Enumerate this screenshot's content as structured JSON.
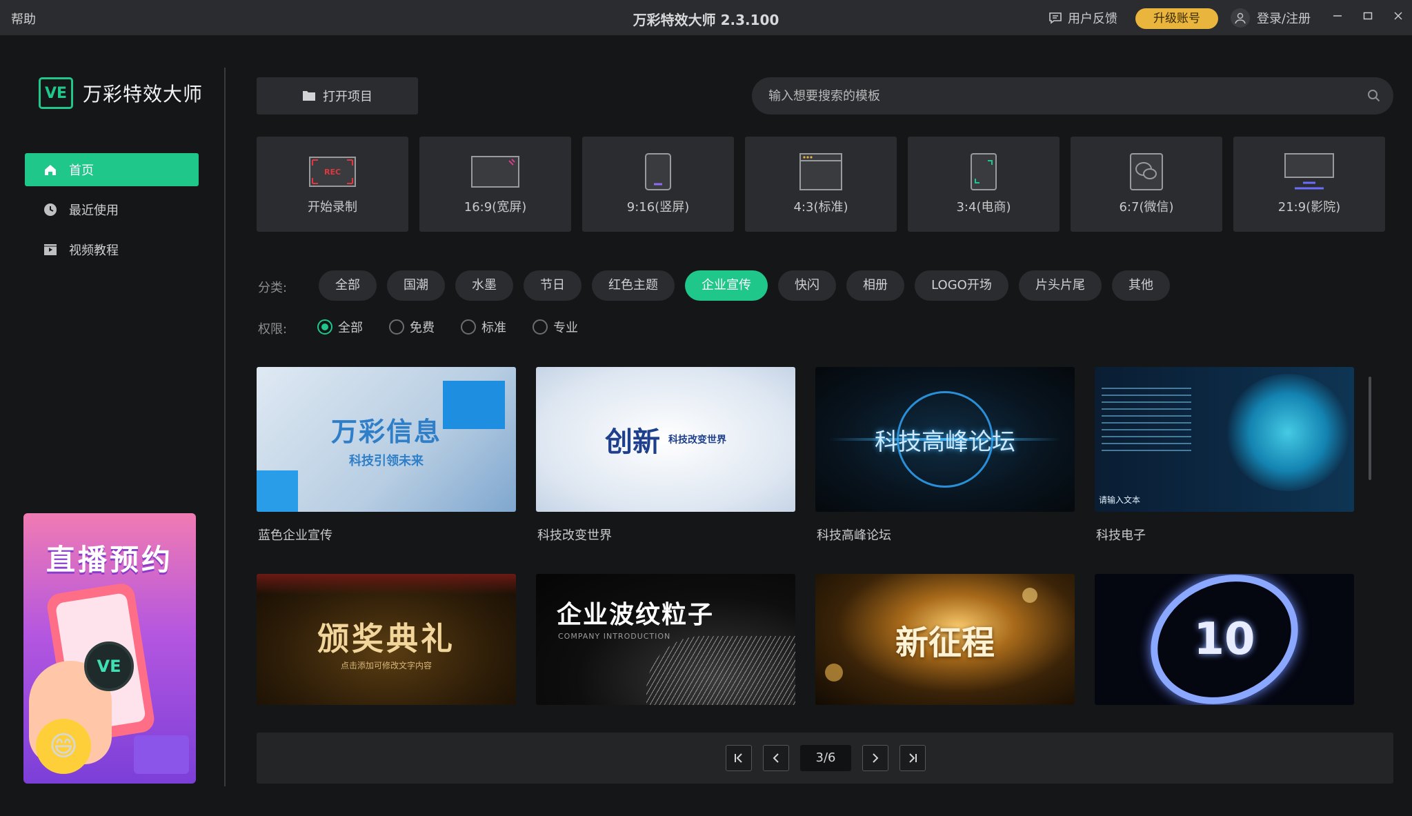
{
  "titlebar": {
    "help_label": "帮助",
    "title": "万彩特效大师 2.3.100",
    "feedback_label": "用户反馈",
    "upgrade_label": "升级账号",
    "login_label": "登录/注册"
  },
  "sidebar": {
    "logo_badge": "VE",
    "logo_name": "万彩特效大师",
    "items": [
      {
        "label": "首页",
        "icon": "home-icon",
        "active": true
      },
      {
        "label": "最近使用",
        "icon": "clock-icon",
        "active": false
      },
      {
        "label": "视频教程",
        "icon": "video-tutorial-icon",
        "active": false
      }
    ],
    "promo": {
      "title": "直播预约",
      "badge": "VE"
    }
  },
  "toolbar": {
    "open_project_label": "打开项目",
    "search_placeholder": "输入想要搜索的模板"
  },
  "ratios": [
    {
      "label": "开始录制",
      "icon": "record-icon",
      "rec_text": "REC"
    },
    {
      "label": "16:9(宽屏)",
      "icon": "widescreen-icon"
    },
    {
      "label": "9:16(竖屏)",
      "icon": "portrait-phone-icon"
    },
    {
      "label": "4:3(标准)",
      "icon": "standard-screen-icon"
    },
    {
      "label": "3:4(电商)",
      "icon": "ecommerce-icon"
    },
    {
      "label": "6:7(微信)",
      "icon": "wechat-icon"
    },
    {
      "label": "21:9(影院)",
      "icon": "cinema-icon"
    }
  ],
  "filters": {
    "category_label": "分类:",
    "categories": [
      "全部",
      "国潮",
      "水墨",
      "节日",
      "红色主题",
      "企业宣传",
      "快闪",
      "相册",
      "LOGO开场",
      "片头片尾",
      "其他"
    ],
    "active_category": "企业宣传",
    "permission_label": "权限:",
    "permissions": [
      "全部",
      "免费",
      "标准",
      "专业"
    ],
    "active_permission": "全部"
  },
  "templates": [
    {
      "title": "蓝色企业宣传",
      "thumb_text": "万彩信息",
      "thumb_sub": "科技引领未来"
    },
    {
      "title": "科技改变世界",
      "thumb_text": "创新",
      "thumb_sub": "科技改变世界"
    },
    {
      "title": "科技高峰论坛",
      "thumb_text": "科技高峰论坛",
      "thumb_sub": ""
    },
    {
      "title": "科技电子",
      "thumb_text": "请输入文本",
      "thumb_sub": ""
    },
    {
      "title": "",
      "thumb_text": "颁奖典礼",
      "thumb_sub": "点击添加可修改文字内容"
    },
    {
      "title": "",
      "thumb_text": "企业波纹粒子",
      "thumb_sub": "COMPANY INTRODUCTION"
    },
    {
      "title": "",
      "thumb_text": "新征程",
      "thumb_sub": ""
    },
    {
      "title": "",
      "thumb_text": "10",
      "thumb_sub": ""
    }
  ],
  "pagination": {
    "current": 3,
    "total": 6,
    "display": "3/6"
  },
  "colors": {
    "accent": "#1fc78b",
    "upgrade": "#e9b53c",
    "background": "#151617",
    "panel": "#2b2c2f"
  }
}
